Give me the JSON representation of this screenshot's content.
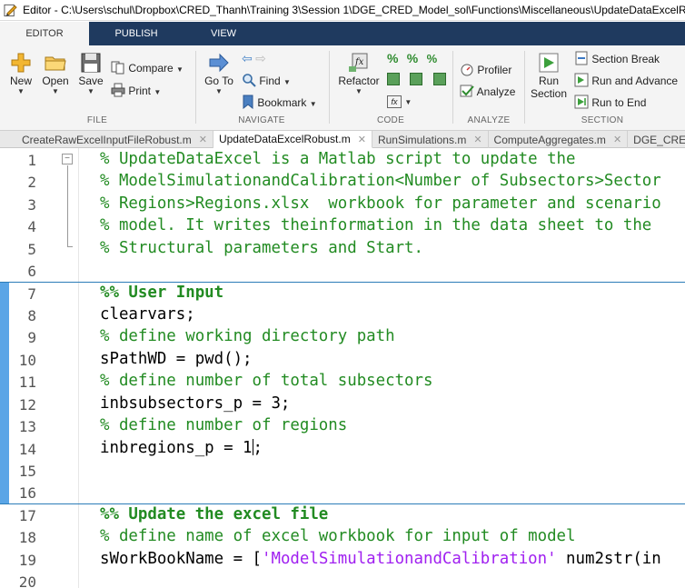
{
  "window": {
    "title": "Editor - C:\\Users\\schul\\Dropbox\\CRED_Thanh\\Training 3\\Session 1\\DGE_CRED_Model_sol\\Functions\\Miscellaneous\\UpdateDataExcelRobust.m"
  },
  "ribbon_tabs": [
    "EDITOR",
    "PUBLISH",
    "VIEW"
  ],
  "ribbon": {
    "file": {
      "group": "FILE",
      "new": "New",
      "open": "Open",
      "save": "Save",
      "compare": "Compare",
      "print": "Print"
    },
    "navigate": {
      "group": "NAVIGATE",
      "goto_line1": "Go To",
      "find": "Find",
      "bookmark": "Bookmark"
    },
    "code": {
      "group": "CODE",
      "refactor": "Refactor"
    },
    "analyze": {
      "group": "ANALYZE",
      "profiler": "Profiler",
      "analyze": "Analyze"
    },
    "section": {
      "group": "SECTION",
      "run_section_1": "Run",
      "run_section_2": "Section",
      "section_break": "Section Break",
      "run_and_advance": "Run and Advance",
      "run_to_end": "Run to End"
    }
  },
  "doc_tabs": [
    "CreateRawExcelInputFileRobust.m",
    "UpdateDataExcelRobust.m",
    "RunSimulations.m",
    "ComputeAggregates.m",
    "DGE_CRED"
  ],
  "code": {
    "line_numbers": [
      "1",
      "2",
      "3",
      "4",
      "5",
      "6",
      "7",
      "8",
      "9",
      "10",
      "11",
      "12",
      "13",
      "14",
      "15",
      "16",
      "17",
      "18",
      "19",
      "20"
    ],
    "l1": "% UpdateDataExcel is a Matlab script to update the",
    "l2": "% ModelSimulationandCalibration<Number of Subsectors>Sector",
    "l3": "% Regions>Regions.xlsx  workbook for parameter and scenario",
    "l4": "% model. It writes theinformation in the data sheet to the",
    "l5": "% Structural parameters and Start.",
    "l7": "%% User Input",
    "l8": "clearvars;",
    "l9": "% define working directory path",
    "l10": "sPathWD = pwd();",
    "l11": "% define number of total subsectors",
    "l12": "inbsubsectors_p = 3;",
    "l13": "% define number of regions",
    "l14a": "inbregions_p = 1",
    "l14b": ";",
    "l17": "%% Update the excel file",
    "l18": "% define name of excel workbook for input of model",
    "l19a": "sWorkBookName = [",
    "l19b": "'ModelSimulationandCalibration'",
    "l19c": " num2str(in"
  },
  "colors": {
    "ribbon_dark": "#1f3a5f",
    "comment": "#228b22",
    "string": "#a020f0",
    "cell_divider": "#2b7cb8",
    "active_cell": "#5aa5e6"
  }
}
